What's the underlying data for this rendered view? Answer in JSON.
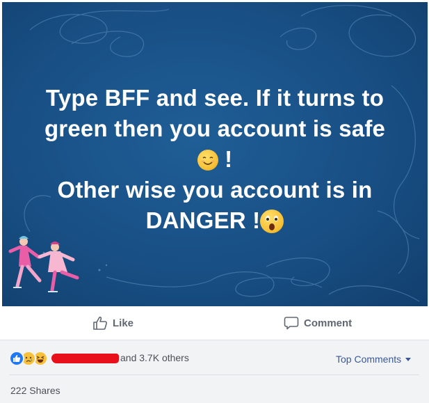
{
  "post": {
    "caption_lines": [
      "Type BFF and see. If it turns to",
      "green then you account is safe",
      "!",
      "Other wise you account is in",
      "DANGER !"
    ],
    "icons": {
      "smile": "smiling-face-emoji",
      "shock": "astonished-face-emoji",
      "art": "ice-skaters-illustration"
    }
  },
  "actions": {
    "like_label": "Like",
    "comment_label": "Comment"
  },
  "reactions": {
    "types": [
      "like",
      "sad",
      "haha"
    ],
    "others_text": "and 3.7K others",
    "sort_label": "Top Comments",
    "shares_text": "222 Shares"
  },
  "colors": {
    "background_blue": "#184f84",
    "link": "#385898",
    "redaction": "#e8101a"
  }
}
